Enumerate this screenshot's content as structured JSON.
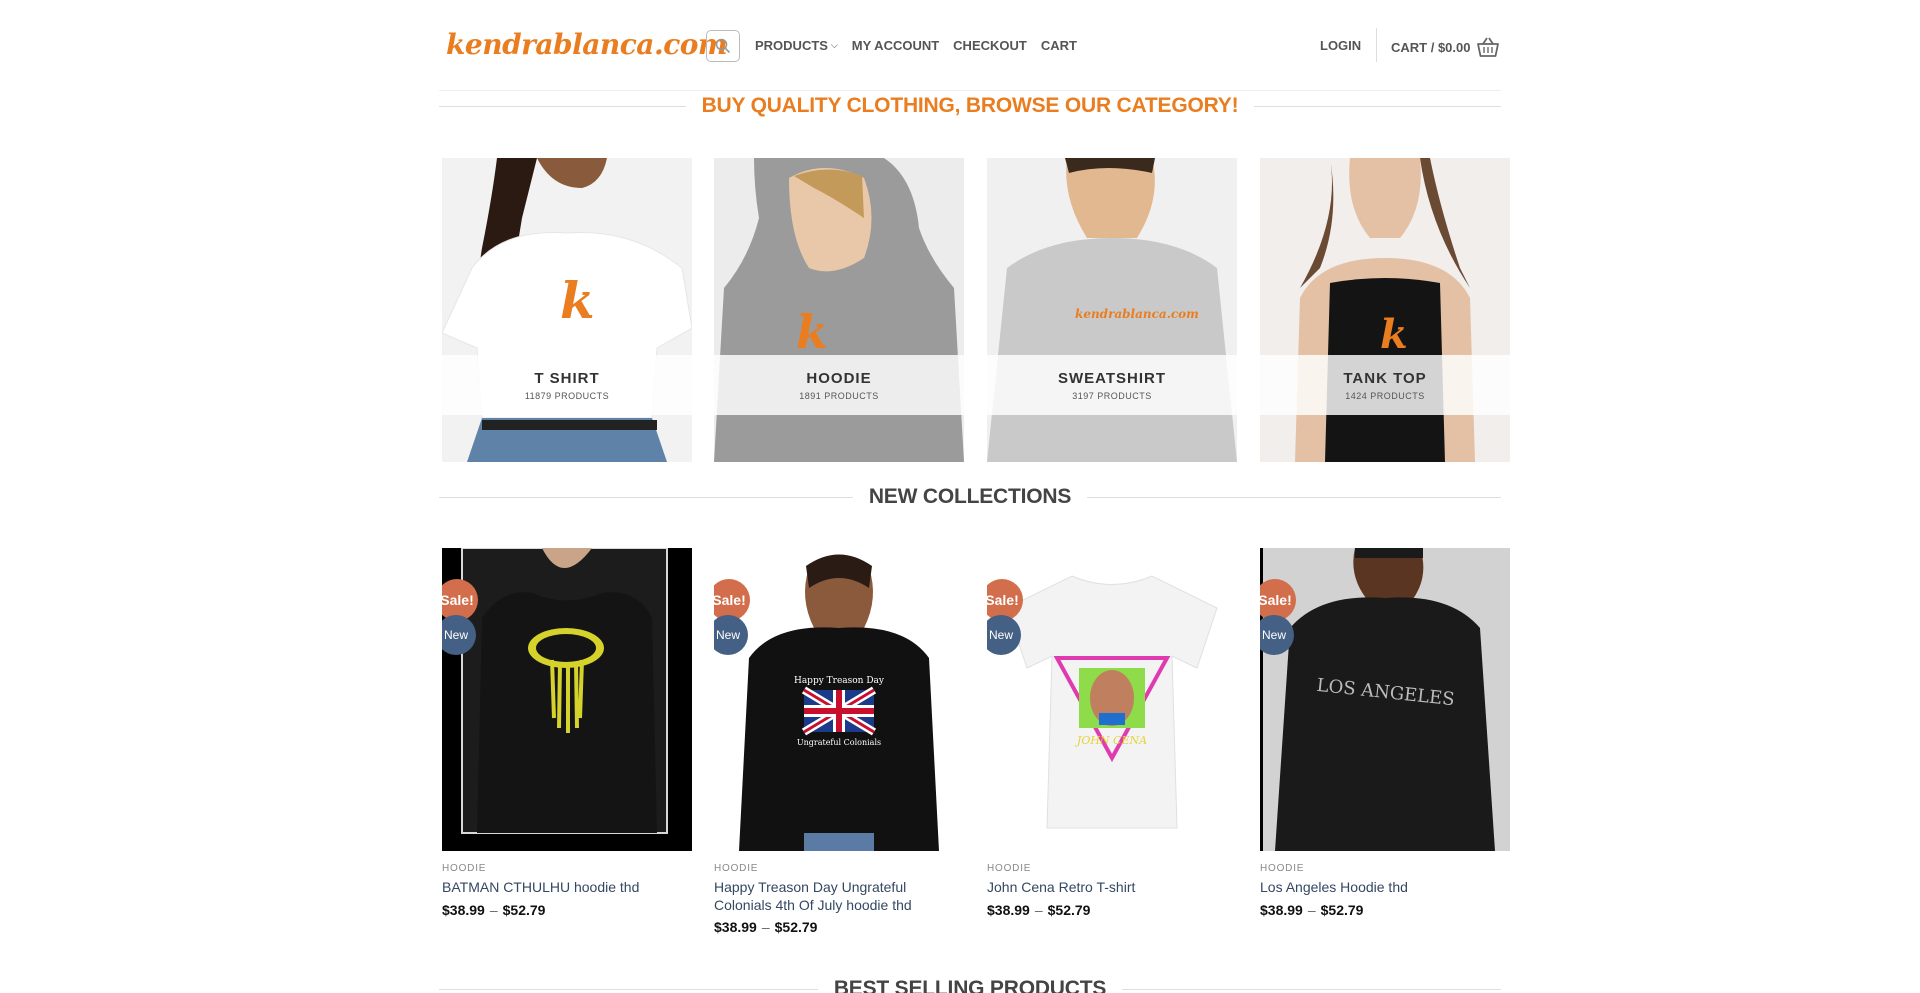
{
  "header": {
    "logo": "kendrablanca.com",
    "nav": [
      {
        "label": "PRODUCTS"
      },
      {
        "label": "MY ACCOUNT"
      },
      {
        "label": "CHECKOUT"
      },
      {
        "label": "CART"
      }
    ],
    "login": "LOGIN",
    "cart_label": "CART / $0.00"
  },
  "sections": {
    "categories_title": "BUY QUALITY CLOTHING, BROWSE OUR CATEGORY!",
    "new_title": "NEW COLLECTIONS",
    "best_title": "BEST SELLING PRODUCTS"
  },
  "categories": [
    {
      "name": "T SHIRT",
      "count": "11879 PRODUCTS"
    },
    {
      "name": "HOODIE",
      "count": "1891 PRODUCTS"
    },
    {
      "name": "SWEATSHIRT",
      "count": "3197 PRODUCTS"
    },
    {
      "name": "TANK TOP",
      "count": "1424 PRODUCTS"
    }
  ],
  "products": [
    {
      "category": "HOODIE",
      "title": "BATMAN CTHULHU hoodie thd",
      "price_min": "$38.99",
      "price_max": "$52.79",
      "sale": "Sale!",
      "new": "New",
      "shirt_text": ""
    },
    {
      "category": "HOODIE",
      "title": "Happy Treason Day Ungrateful Colonials 4th Of July hoodie thd",
      "price_min": "$38.99",
      "price_max": "$52.79",
      "sale": "Sale!",
      "new": "New",
      "shirt_text": "Happy Treason Day"
    },
    {
      "category": "HOODIE",
      "title": "John Cena Retro T-shirt",
      "price_min": "$38.99",
      "price_max": "$52.79",
      "sale": "Sale!",
      "new": "New",
      "shirt_text": "JOHN CENA"
    },
    {
      "category": "HOODIE",
      "title": "Los Angeles Hoodie thd",
      "price_min": "$38.99",
      "price_max": "$52.79",
      "sale": "Sale!",
      "new": "New",
      "shirt_text": "LOS ANGELES"
    }
  ],
  "shirt_secondary": "Ungrateful Colonials",
  "colors": {
    "brand": "#ea7d1f",
    "sale": "#d26e4b",
    "new": "#446084",
    "link": "#334862"
  }
}
